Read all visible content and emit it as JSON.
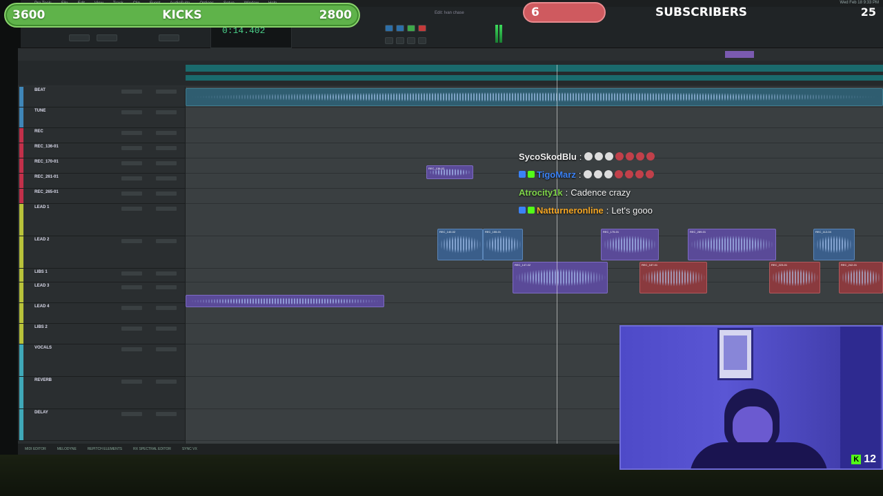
{
  "overlays": {
    "kicks_left": "3600",
    "kicks_label": "KICKS",
    "kicks_right": "2800",
    "subs_current": "6",
    "subs_label": "SUBSCRIBERS",
    "subs_goal": "25"
  },
  "window": {
    "menu": [
      "Pro Tools",
      "File",
      "Edit",
      "View",
      "Track",
      "Clip",
      "Event",
      "AudioSuite",
      "Options",
      "Setup",
      "Window",
      "Help"
    ],
    "title": "Edit: Ivan chase",
    "date": "Wed Feb 18 9:33 PM"
  },
  "transport": {
    "counter": "0:14.402"
  },
  "tracks": [
    {
      "name": "BEAT",
      "color": "#3f86b8"
    },
    {
      "name": "TUNE",
      "color": "#3f86b8"
    },
    {
      "name": "REC",
      "color": "#c2304a"
    },
    {
      "name": "REC_136-01",
      "color": "#c2304a"
    },
    {
      "name": "REC_170-01",
      "color": "#c2304a"
    },
    {
      "name": "REC_261-01",
      "color": "#c2304a"
    },
    {
      "name": "REC_265-01",
      "color": "#c2304a"
    },
    {
      "name": "LEAD 1",
      "color": "#b8c23a"
    },
    {
      "name": "LEAD 2",
      "color": "#b8c23a"
    },
    {
      "name": "LIBS 1",
      "color": "#b8c23a"
    },
    {
      "name": "LEAD 3",
      "color": "#b8c23a"
    },
    {
      "name": "LEAD 4",
      "color": "#b8c23a"
    },
    {
      "name": "LIBS 2",
      "color": "#b8c23a"
    },
    {
      "name": "VOCALS",
      "color": "#3fa8b8"
    },
    {
      "name": "REVERB",
      "color": "#3fa8b8"
    },
    {
      "name": "DELAY",
      "color": "#3fa8b8"
    }
  ],
  "clips": [
    {
      "label": "REC_136-02",
      "kind": "purple"
    },
    {
      "label": "REC_140-02",
      "kind": "blue"
    },
    {
      "label": "REC_155-01",
      "kind": "blue"
    },
    {
      "label": "REC_175-01",
      "kind": "purple"
    },
    {
      "label": "REC_289-01",
      "kind": "purple"
    },
    {
      "label": "REC_112-04",
      "kind": "blue"
    },
    {
      "label": "REC_147-02",
      "kind": "purple"
    },
    {
      "label": "REC_187-01",
      "kind": "red"
    },
    {
      "label": "REC_223-01",
      "kind": "red"
    },
    {
      "label": "REC_242-01",
      "kind": "red"
    }
  ],
  "chat": [
    {
      "user": "SycoSkodBlu",
      "message": "",
      "user_color": "#f2f2f2"
    },
    {
      "user": "TigoMarz",
      "message": "",
      "user_color": "#3b82f6"
    },
    {
      "user": "Atrocity1k",
      "message": "Cadence crazy",
      "user_color": "#7fd44a"
    },
    {
      "user": "Natturneronline",
      "message": "Let's gooo",
      "user_color": "#f5a623"
    }
  ],
  "bottom_bar": [
    "MIDI EDITOR",
    "MELODYNE",
    "REPITCH ELEMENTS",
    "RX SPECTRAL EDITOR",
    "SYNC VX"
  ],
  "webcam": {
    "kick_viewers": "12"
  },
  "icons": {
    "kick_logo": "kick-logo-icon"
  }
}
